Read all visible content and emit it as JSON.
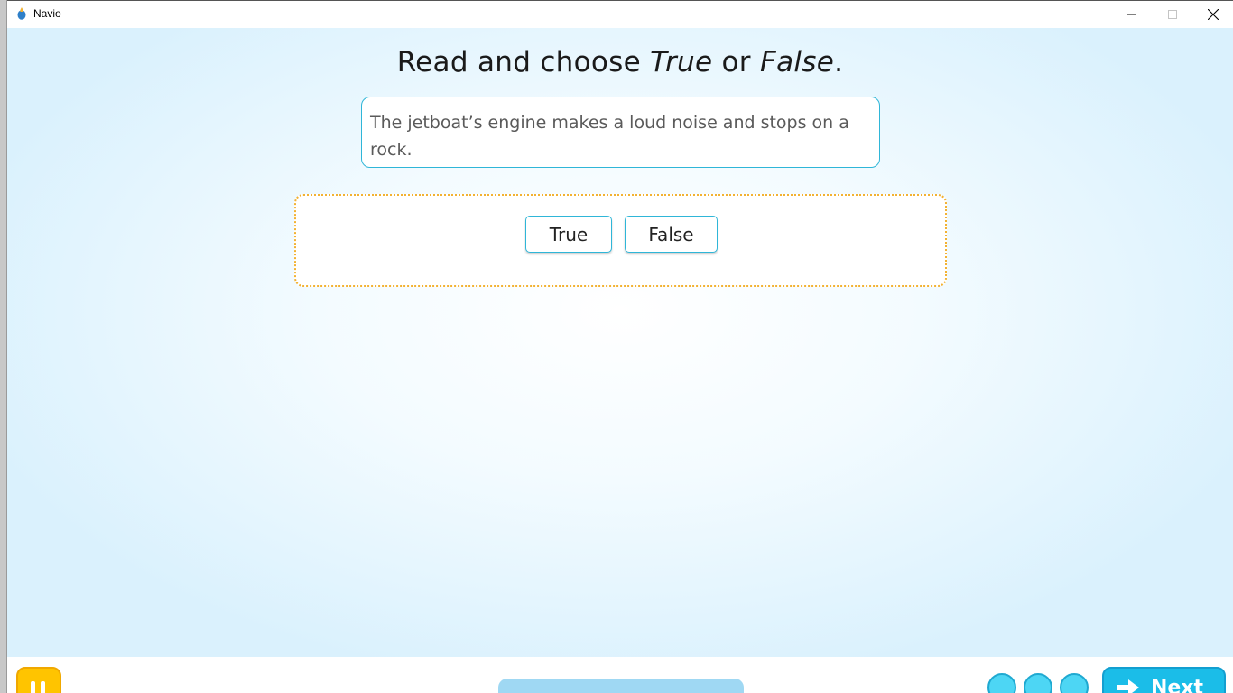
{
  "window": {
    "title": "Navio"
  },
  "instruction": {
    "prefix": "Read and choose ",
    "word_true": "True",
    "middle": " or ",
    "word_false": "False",
    "suffix": "."
  },
  "sentence": {
    "text": "The jetboat’s engine makes a loud noise and stops on a rock."
  },
  "choices": {
    "true_label": "True",
    "false_label": "False"
  },
  "footer": {
    "next_label": "Next"
  },
  "colors": {
    "accent": "#2fb6d8",
    "drop_zone_border": "#f2b233",
    "pause_button": "#ffc400",
    "next_button": "#1bbde8",
    "progress_track": "#9fd8f3",
    "dot": "#4dd6f4"
  }
}
